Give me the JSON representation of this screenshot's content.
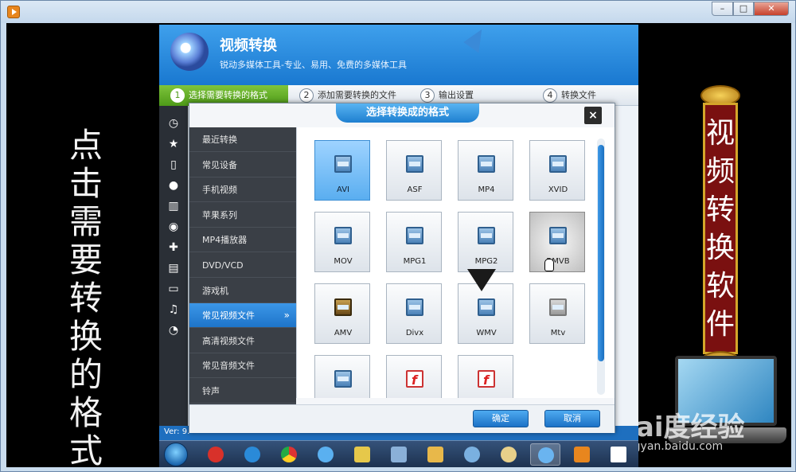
{
  "colors": {
    "accent": "#1e74c9",
    "step_active": "#4e9a18",
    "sidebar": "#3a3f46"
  },
  "app": {
    "title": "视频转换",
    "subtitle": "锐动多媒体工具-专业、易用、免费的多媒体工具",
    "version": "Ver: 9."
  },
  "steps": [
    {
      "num": "1",
      "label": "选择需要转换的格式"
    },
    {
      "num": "2",
      "label": "添加需要转换的文件"
    },
    {
      "num": "3",
      "label": "输出设置"
    },
    {
      "num": "4",
      "label": "转换文件"
    }
  ],
  "dialog": {
    "title": "选择转换成的格式",
    "close": "×",
    "categories": [
      "最近转换",
      "常见设备",
      "手机视频",
      "苹果系列",
      "MP4播放器",
      "DVD/VCD",
      "游戏机",
      "常见视频文件",
      "高清视频文件",
      "常见音频文件",
      "铃声"
    ],
    "active_category": "常见视频文件",
    "active_chevron": "»",
    "formats": [
      {
        "label": "AVI",
        "icon": "video-file-icon",
        "state": "selected"
      },
      {
        "label": "ASF",
        "icon": "video-file-icon",
        "state": "normal"
      },
      {
        "label": "MP4",
        "icon": "video-file-icon",
        "state": "normal"
      },
      {
        "label": "XVID",
        "icon": "video-file-icon",
        "state": "normal"
      },
      {
        "label": "MOV",
        "icon": "video-file-icon",
        "state": "normal"
      },
      {
        "label": "MPG1",
        "icon": "video-file-icon",
        "state": "normal"
      },
      {
        "label": "MPG2",
        "icon": "video-file-icon",
        "state": "normal"
      },
      {
        "label": "RMVB",
        "icon": "video-file-icon",
        "state": "hover"
      },
      {
        "label": "AMV",
        "icon": "film-icon",
        "state": "normal"
      },
      {
        "label": "Divx",
        "icon": "video-file-icon",
        "state": "normal"
      },
      {
        "label": "WMV",
        "icon": "video-file-icon",
        "state": "normal"
      },
      {
        "label": "Mtv",
        "icon": "tv-icon",
        "state": "normal"
      },
      {
        "label": "",
        "icon": "video-file-icon",
        "state": "normal"
      },
      {
        "label": "",
        "icon": "flash-video-icon",
        "state": "normal"
      },
      {
        "label": "",
        "icon": "swf-file-icon",
        "state": "normal"
      }
    ],
    "ok_label": "确定",
    "cancel_label": "取消"
  },
  "overlay": {
    "left_caption": "点击需要转换的格式",
    "right_caption": "视频转换软件",
    "watermark_logo": "Bai度经验",
    "watermark_url": "jingyan.baidu.com"
  },
  "sidebar_icons": [
    "clock-icon",
    "star-icon",
    "phone-icon",
    "apple-icon",
    "chart-icon",
    "disc-icon",
    "gamepad-icon",
    "film-icon",
    "hd-icon",
    "music-note-icon",
    "ringtone-icon"
  ],
  "taskbar_icons": [
    "start-orb-icon",
    "jiang-app-icon",
    "ie-icon",
    "chrome-icon",
    "browser-icon",
    "notes-icon",
    "network-icon",
    "folder-icon",
    "app-swirl-icon",
    "paint-icon",
    "video-convert-icon",
    "media-player-icon",
    "windows-flag-icon"
  ]
}
